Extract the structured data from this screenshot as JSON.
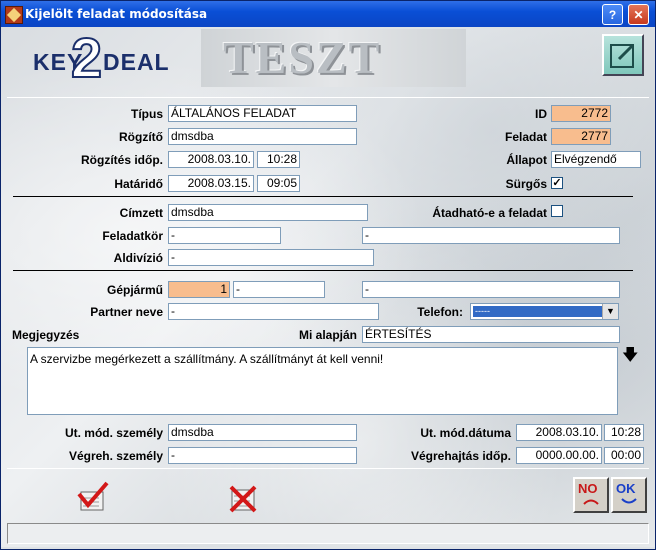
{
  "window": {
    "title": "Kijelölt feladat módosítása",
    "help_label": "?",
    "close_label": "✕"
  },
  "logo": {
    "left": "KEY",
    "mid": "2",
    "right": "DEAL"
  },
  "banner": {
    "text": "TESZT"
  },
  "fields": {
    "tipus": {
      "label": "Típus",
      "value": "ÁLTALÁNOS FELADAT"
    },
    "rogzito": {
      "label": "Rögzítő",
      "value": "dmsdba"
    },
    "rogzites_idop": {
      "label": "Rögzítés időp.",
      "date": "2008.03.10.",
      "time": "10:28"
    },
    "hatarido": {
      "label": "Határidő",
      "date": "2008.03.15.",
      "time": "09:05"
    },
    "id": {
      "label": "ID",
      "value": "2772"
    },
    "feladat": {
      "label": "Feladat",
      "value": "2777"
    },
    "allapot": {
      "label": "Állapot",
      "value": "Elvégzendő"
    },
    "surgos": {
      "label": "Sürgős",
      "checked": true
    },
    "cimzett": {
      "label": "Címzett",
      "value": "dmsdba"
    },
    "atadhato": {
      "label": "Átadható-e a feladat",
      "checked": false
    },
    "feladatkor": {
      "label": "Feladatkör",
      "value": "-",
      "value2": "-"
    },
    "aldivizio": {
      "label": "Aldivízió",
      "value": "-"
    },
    "gepjarmu": {
      "label": "Gépjármű",
      "value": "1",
      "value2": "-",
      "value3": "-"
    },
    "partner_neve": {
      "label": "Partner neve",
      "value": "-"
    },
    "telefon": {
      "label": "Telefon:",
      "selected": "-----"
    },
    "megjegyzes": {
      "label": "Megjegyzés",
      "text": "A szervizbe megérkezett a szállítmány. A szállítmányt át kell venni!"
    },
    "mi_alapjan": {
      "label": "Mi alapján",
      "value": "ÉRTESÍTÉS"
    },
    "ut_mod_szemely": {
      "label": "Ut. mód. személy",
      "value": "dmsdba"
    },
    "vegreh_szemely": {
      "label": "Végreh. személy",
      "value": "-"
    },
    "ut_mod_datuma": {
      "label": "Ut. mód.dátuma",
      "date": "2008.03.10.",
      "time": "10:28"
    },
    "vegrehajtas_idop": {
      "label": "Végrehajtás időp.",
      "date": "0000.00.00.",
      "time": "00:00"
    }
  },
  "buttons": {
    "no_label": "NO",
    "ok_label": "OK"
  }
}
